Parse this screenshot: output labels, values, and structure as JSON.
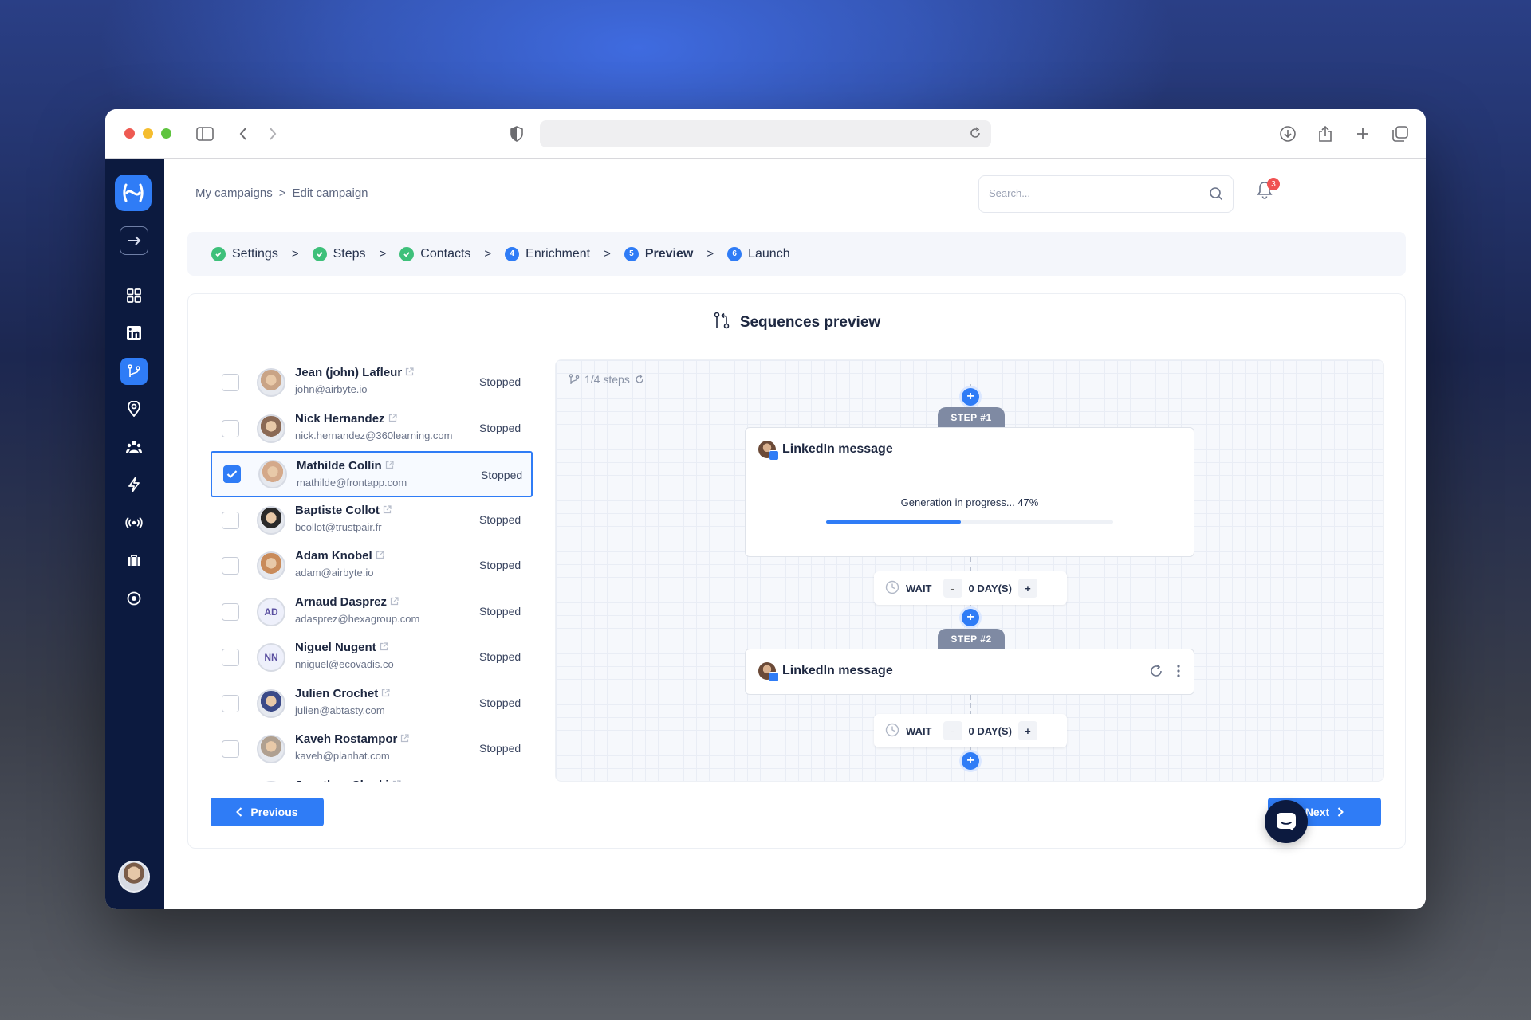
{
  "browser": {
    "url": ""
  },
  "breadcrumb": {
    "root": "My campaigns",
    "separator": ">",
    "current": "Edit campaign"
  },
  "search": {
    "placeholder": "Search..."
  },
  "notifications": {
    "count": "3"
  },
  "stepper": {
    "separator": ">",
    "steps": [
      {
        "label": "Settings",
        "status": "done",
        "number": "1"
      },
      {
        "label": "Steps",
        "status": "done",
        "number": "2"
      },
      {
        "label": "Contacts",
        "status": "done",
        "number": "3"
      },
      {
        "label": "Enrichment",
        "status": "todo",
        "number": "4"
      },
      {
        "label": "Preview",
        "status": "current",
        "number": "5"
      },
      {
        "label": "Launch",
        "status": "todo",
        "number": "6"
      }
    ]
  },
  "preview": {
    "title": "Sequences preview",
    "steps_count": "1/4 steps"
  },
  "contacts": [
    {
      "name": "Jean (john) Lafleur",
      "email": "john@airbyte.io",
      "status": "Stopped",
      "initials": "",
      "checked": false
    },
    {
      "name": "Nick Hernandez",
      "email": "nick.hernandez@360learning.com",
      "status": "Stopped",
      "initials": "",
      "checked": false
    },
    {
      "name": "Mathilde Collin",
      "email": "mathilde@frontapp.com",
      "status": "Stopped",
      "initials": "",
      "checked": true
    },
    {
      "name": "Baptiste Collot",
      "email": "bcollot@trustpair.fr",
      "status": "Stopped",
      "initials": "",
      "checked": false
    },
    {
      "name": "Adam Knobel",
      "email": "adam@airbyte.io",
      "status": "Stopped",
      "initials": "",
      "checked": false
    },
    {
      "name": "Arnaud Dasprez",
      "email": "adasprez@hexagroup.com",
      "status": "Stopped",
      "initials": "AD",
      "checked": false
    },
    {
      "name": "Niguel Nugent",
      "email": "nniguel@ecovadis.co",
      "status": "Stopped",
      "initials": "NN",
      "checked": false
    },
    {
      "name": "Julien Crochet",
      "email": "julien@abtasty.com",
      "status": "Stopped",
      "initials": "",
      "checked": false
    },
    {
      "name": "Kaveh Rostampor",
      "email": "kaveh@planhat.com",
      "status": "Stopped",
      "initials": "",
      "checked": false
    },
    {
      "name": "Jonathan Cherki",
      "email": "",
      "status": "",
      "initials": "",
      "checked": false
    }
  ],
  "sequence": {
    "step1": {
      "tag": "STEP #1",
      "title": "LinkedIn message",
      "progress_text": "Generation in progress... 47%",
      "progress": 0.47
    },
    "wait1": {
      "label": "WAIT",
      "minus": "-",
      "days": "0 DAY(S)",
      "plus": "+"
    },
    "step2": {
      "tag": "STEP #2",
      "title": "LinkedIn message"
    },
    "wait2": {
      "label": "WAIT",
      "minus": "-",
      "days": "0 DAY(S)",
      "plus": "+"
    }
  },
  "actions": {
    "previous": "Previous",
    "next": "Next"
  },
  "colors": {
    "accent": "#2f7cf6",
    "sidebar": "#0c1a3f",
    "success": "#3ec07a",
    "badge": "#f05252"
  }
}
